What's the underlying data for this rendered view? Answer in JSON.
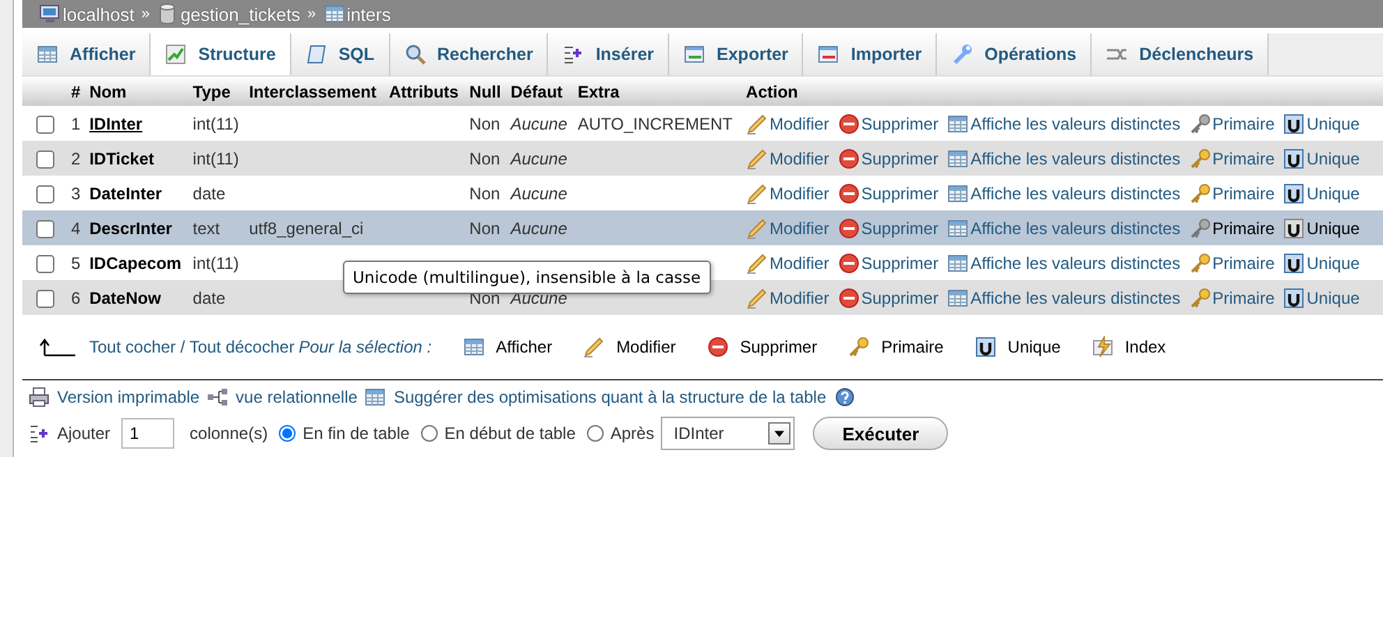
{
  "breadcrumb": [
    {
      "label": "localhost",
      "kind": "server"
    },
    {
      "label": "gestion_tickets",
      "kind": "database",
      "separator": "»"
    },
    {
      "label": "inters",
      "kind": "table",
      "separator": "»"
    }
  ],
  "tabs": [
    {
      "label": "Afficher",
      "kind": "browse",
      "selected": false
    },
    {
      "label": "Structure",
      "kind": "structure",
      "selected": true
    },
    {
      "label": "SQL",
      "kind": "sql",
      "selected": false
    },
    {
      "label": "Rechercher",
      "kind": "search",
      "selected": false
    },
    {
      "label": "Insérer",
      "kind": "insert",
      "selected": false
    },
    {
      "label": "Exporter",
      "kind": "export",
      "selected": false
    },
    {
      "label": "Importer",
      "kind": "import",
      "selected": false
    },
    {
      "label": "Opérations",
      "kind": "operations",
      "selected": false
    },
    {
      "label": "Déclencheurs",
      "kind": "triggers",
      "selected": false
    }
  ],
  "table": {
    "columns": [
      "#",
      "Nom",
      "Type",
      "Interclassement",
      "Attributs",
      "Null",
      "Défaut",
      "Extra",
      "Action"
    ],
    "rows": [
      {
        "number": "1",
        "name": "IDInter",
        "type": "int(11)",
        "null": "Non",
        "default": "Aucune",
        "extra": "AUTO_INCREMENT",
        "checked": false,
        "primary": true,
        "hovered": false,
        "actions": [
          {
            "label": "Modifier",
            "kind": "edit"
          },
          {
            "label": "Supprimer",
            "kind": "drop"
          },
          {
            "label": "Affiche les valeurs distinctes",
            "kind": "browse"
          },
          {
            "label": "Primaire",
            "kind": "primary"
          },
          {
            "label": "Unique",
            "kind": "unique"
          }
        ]
      },
      {
        "number": "2",
        "name": "IDTicket",
        "type": "int(11)",
        "null": "Non",
        "default": "Aucune",
        "checked": false,
        "primary": false,
        "hovered": false,
        "actions": [
          {
            "label": "Modifier",
            "kind": "edit"
          },
          {
            "label": "Supprimer",
            "kind": "drop"
          },
          {
            "label": "Affiche les valeurs distinctes",
            "kind": "browse"
          },
          {
            "label": "Primaire",
            "kind": "primary"
          },
          {
            "label": "Unique",
            "kind": "unique"
          }
        ]
      },
      {
        "number": "3",
        "name": "DateInter",
        "type": "date",
        "null": "Non",
        "default": "Aucune",
        "checked": false,
        "primary": false,
        "hovered": false,
        "actions": [
          {
            "label": "Modifier",
            "kind": "edit"
          },
          {
            "label": "Supprimer",
            "kind": "drop"
          },
          {
            "label": "Affiche les valeurs distinctes",
            "kind": "browse"
          },
          {
            "label": "Primaire",
            "kind": "primary"
          },
          {
            "label": "Unique",
            "kind": "unique"
          }
        ]
      },
      {
        "number": "4",
        "name": "DescrInter",
        "type": "text",
        "collation": "utf8_general_ci",
        "null": "Non",
        "default": "Aucune",
        "checked": false,
        "primary": false,
        "hovered": true,
        "actions": [
          {
            "label": "Modifier",
            "kind": "edit"
          },
          {
            "label": "Supprimer",
            "kind": "drop"
          },
          {
            "label": "Affiche les valeurs distinctes",
            "kind": "browse"
          },
          {
            "label": "Primaire",
            "kind": "primary"
          },
          {
            "label": "Unique",
            "kind": "unique"
          }
        ]
      },
      {
        "number": "5",
        "name": "IDCapecom",
        "type": "int(11)",
        "checked": false,
        "primary": false,
        "hovered": false,
        "actions": [
          {
            "label": "Modifier",
            "kind": "edit"
          },
          {
            "label": "Supprimer",
            "kind": "drop"
          },
          {
            "label": "Affiche les valeurs distinctes",
            "kind": "browse"
          },
          {
            "label": "Primaire",
            "kind": "primary"
          },
          {
            "label": "Unique",
            "kind": "unique"
          }
        ]
      },
      {
        "number": "6",
        "name": "DateNow",
        "type": "date",
        "null": "Non",
        "default": "Aucune",
        "checked": false,
        "primary": false,
        "hovered": false,
        "actions": [
          {
            "label": "Modifier",
            "kind": "edit"
          },
          {
            "label": "Supprimer",
            "kind": "drop"
          },
          {
            "label": "Affiche les valeurs distinctes",
            "kind": "browse"
          },
          {
            "label": "Primaire",
            "kind": "primary"
          },
          {
            "label": "Unique",
            "kind": "unique"
          }
        ]
      }
    ]
  },
  "tooltip": {
    "text": "Unicode (multilingue), insensible à la casse"
  },
  "bulk": {
    "check_all": "Tout cocher / Tout décocher",
    "with_selected": "Pour la sélection :",
    "actions": [
      {
        "label": "Afficher",
        "kind": "browse"
      },
      {
        "label": "Modifier",
        "kind": "edit"
      },
      {
        "label": "Supprimer",
        "kind": "drop"
      },
      {
        "label": "Primaire",
        "kind": "primary"
      },
      {
        "label": "Unique",
        "kind": "unique"
      },
      {
        "label": "Index",
        "kind": "index"
      }
    ]
  },
  "links": [
    {
      "label": "Version imprimable",
      "kind": "print"
    },
    {
      "label": "vue relationnelle",
      "kind": "relation"
    },
    {
      "label": "Suggérer des optimisations quant à la structure de la table",
      "kind": "optimize"
    }
  ],
  "add_column": {
    "label": "Ajouter",
    "count": "1",
    "unit": "colonne(s)",
    "positions": [
      {
        "label": "En fin de table",
        "selected": true
      },
      {
        "label": "En début de table",
        "selected": false
      },
      {
        "label": "Après",
        "selected": false
      }
    ],
    "after_field": "IDInter",
    "submit": "Exécuter"
  }
}
